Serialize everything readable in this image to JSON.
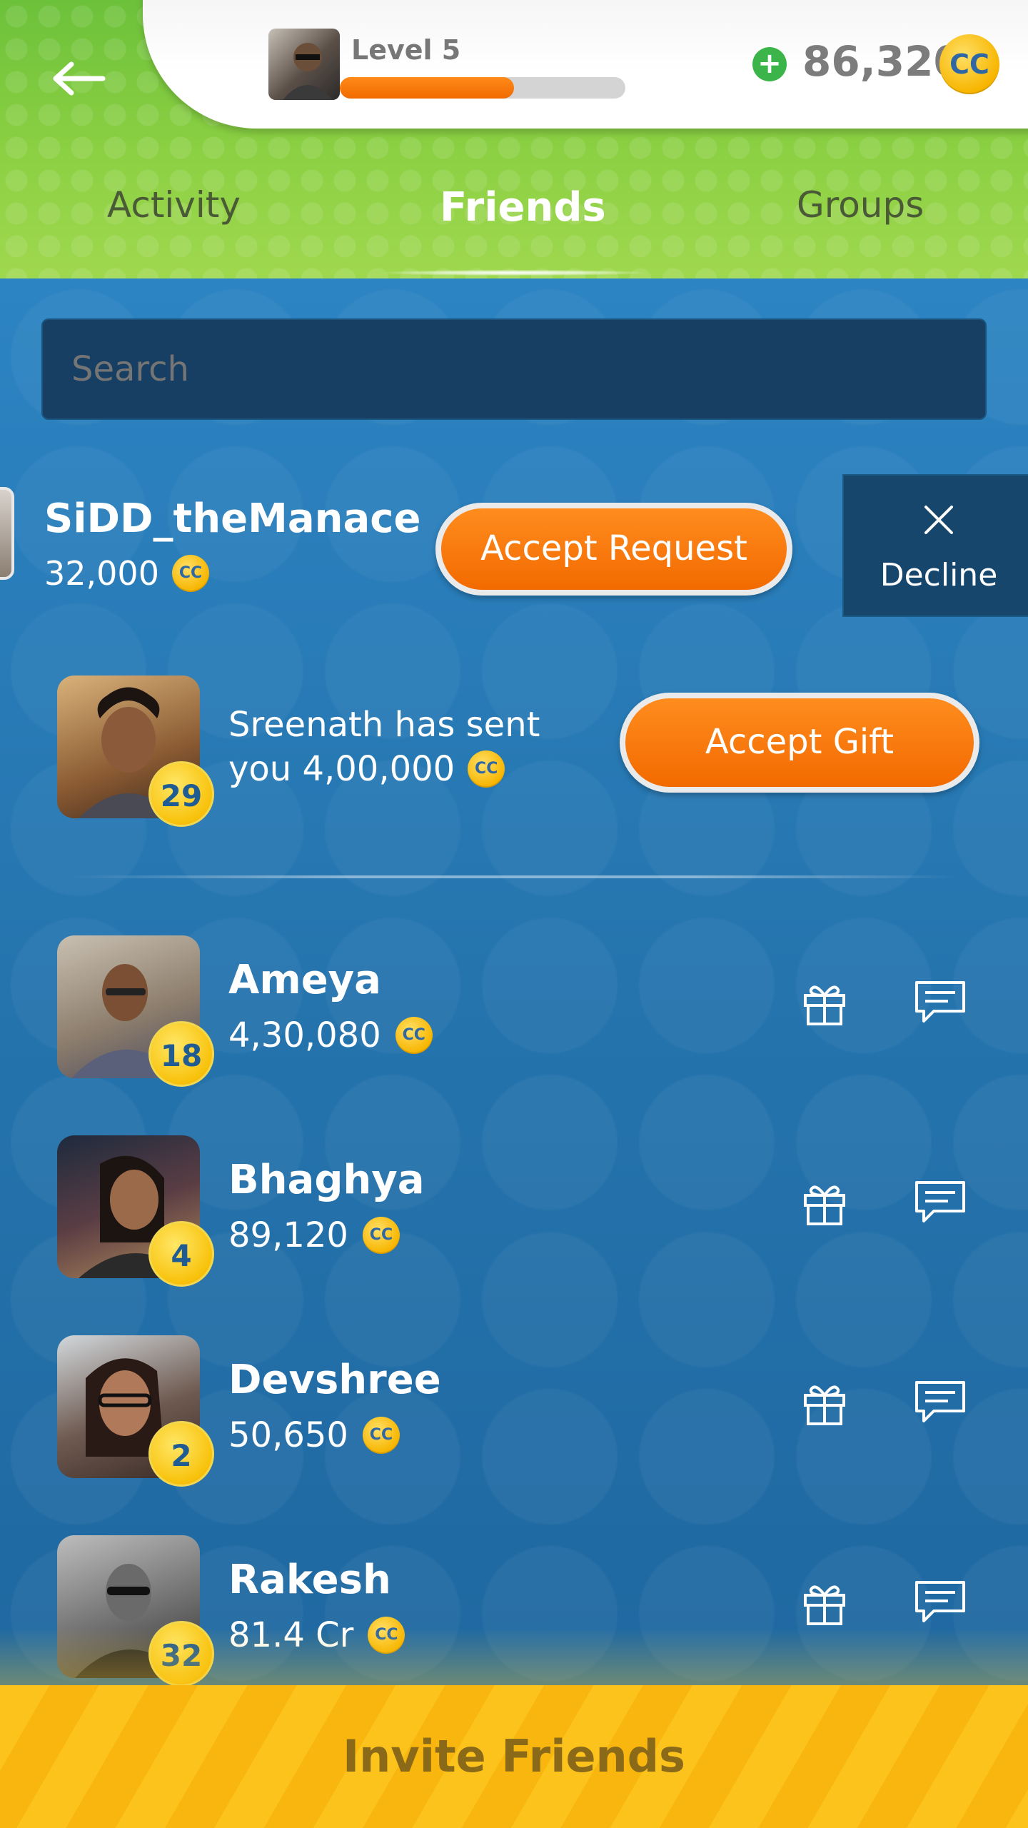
{
  "header": {
    "back_icon": "arrow-left-icon",
    "level_label": "Level 5",
    "xp_progress": 0.61,
    "add_coins_icon": "plus-circle-icon",
    "balance": "86,320",
    "coin_label": "CC"
  },
  "tabs": [
    {
      "label": "Activity",
      "active": false
    },
    {
      "label": "Friends",
      "active": true
    },
    {
      "label": "Groups",
      "active": false
    }
  ],
  "search": {
    "placeholder": "Search"
  },
  "friend_request": {
    "name": "SiDD_theManace",
    "coins": "32,000",
    "accept_label": "Accept Request",
    "decline_label": "Decline",
    "decline_icon": "close-icon"
  },
  "gift": {
    "line1": "Sreenath has sent",
    "line2": "you 4,00,000",
    "level": "29",
    "accept_label": "Accept Gift"
  },
  "friends": [
    {
      "name": "Ameya",
      "coins": "4,30,080",
      "level": "18"
    },
    {
      "name": "Bhaghya",
      "coins": "89,120",
      "level": "4"
    },
    {
      "name": "Devshree",
      "coins": "50,650",
      "level": "2"
    },
    {
      "name": "Rakesh",
      "coins": "81.4 Cr",
      "level": "32"
    }
  ],
  "invite": {
    "label": "Invite Friends"
  },
  "colors": {
    "green_header": "#8cd043",
    "blue_bg": "#2a7bb8",
    "orange_button": "#f26a00",
    "yellow_footer": "#fcc31c",
    "coin_gold": "#f7b500"
  }
}
